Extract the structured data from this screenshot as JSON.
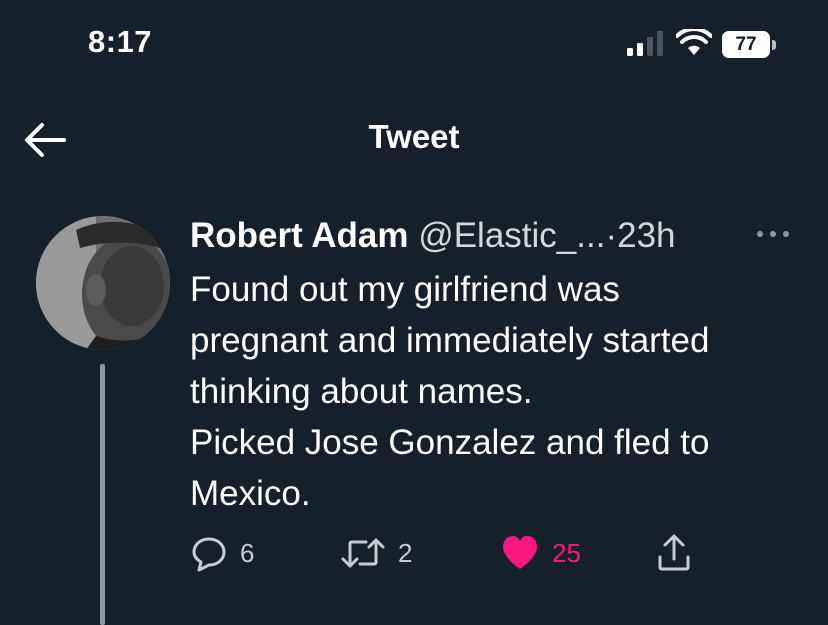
{
  "status_bar": {
    "time": "8:17",
    "battery": "77"
  },
  "header": {
    "title": "Tweet"
  },
  "tweet": {
    "author_name": "Robert Adam",
    "author_handle": "@Elastic_...",
    "dot": "·",
    "time": "23h",
    "text_lines": [
      "Found out my girlfriend was",
      "pregnant and immediately started",
      "thinking about names.",
      "Picked Jose Gonzalez and fled to",
      "Mexico."
    ],
    "actions": {
      "replies": "6",
      "retweets": "2",
      "likes": "25"
    }
  },
  "icons": {
    "back": "arrow-left-icon",
    "more": "more-horizontal-icon",
    "reply": "speech-bubble-icon",
    "retweet": "retweet-icon",
    "like": "heart-icon",
    "share": "share-icon"
  },
  "colors": {
    "background": "#15202b",
    "like": "#f91880",
    "thread_line": "#8899a6"
  }
}
